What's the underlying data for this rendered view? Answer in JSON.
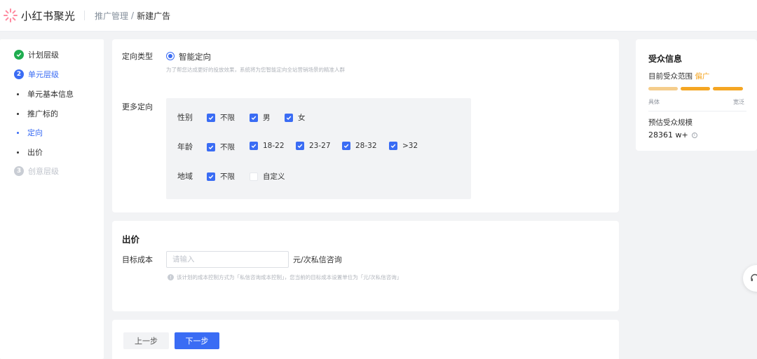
{
  "app": {
    "name": "小红书聚光"
  },
  "breadcrumb": {
    "parent": "推广管理",
    "separator": "/",
    "current": "新建广告"
  },
  "sidebar": {
    "steps": [
      {
        "label": "计划层级",
        "status": "done"
      },
      {
        "number": "2",
        "label": "单元层级",
        "status": "active",
        "substeps": [
          {
            "label": "单元基本信息",
            "active": false
          },
          {
            "label": "推广标的",
            "active": false
          },
          {
            "label": "定向",
            "active": true
          },
          {
            "label": "出价",
            "active": false
          }
        ]
      },
      {
        "number": "3",
        "label": "创意层级",
        "status": "pending"
      }
    ]
  },
  "targeting": {
    "type_label": "定向类型",
    "type_option": "智能定向",
    "type_hint": "为了帮您达成更好的投放效果，系统将为您智能定向全站营销场景的精准人群",
    "more_label": "更多定向",
    "gender": {
      "label": "性别",
      "options": [
        {
          "label": "不限",
          "checked": true
        },
        {
          "label": "男",
          "checked": true
        },
        {
          "label": "女",
          "checked": true
        }
      ]
    },
    "age": {
      "label": "年龄",
      "options": [
        {
          "label": "不限",
          "checked": true
        },
        {
          "label": "18-22",
          "checked": true
        },
        {
          "label": "23-27",
          "checked": true
        },
        {
          "label": "28-32",
          "checked": true
        },
        {
          "label": ">32",
          "checked": true
        }
      ]
    },
    "region": {
      "label": "地域",
      "options": [
        {
          "label": "不限",
          "checked": true
        },
        {
          "label": "自定义",
          "checked": false
        }
      ]
    }
  },
  "bid": {
    "title": "出价",
    "target_cost_label": "目标成本",
    "placeholder": "请输入",
    "unit": "元/次私信咨询",
    "hint": "该计划的成本控制方式为「私信咨询成本控制」，您当前的目标成本设置单位为「元/次私信咨询」"
  },
  "actions": {
    "prev": "上一步",
    "next": "下一步"
  },
  "audience": {
    "title": "受众信息",
    "range_label": "目前受众范围",
    "range_value": "偏广",
    "scale_left": "具体",
    "scale_right": "宽泛",
    "size_label": "预估受众规模",
    "size_value": "28361 w+",
    "colors": {
      "bar_light": "#f5cd8c",
      "bar": "#f5a623",
      "range_value": "#f5a623"
    }
  },
  "colors": {
    "primary": "#3a6cf4",
    "success": "#1fad50",
    "logo_red": "#ff2442"
  },
  "icons": {
    "logo": "flower-logo-icon",
    "check": "check-icon",
    "info": "info-icon",
    "float": "headset-icon"
  }
}
